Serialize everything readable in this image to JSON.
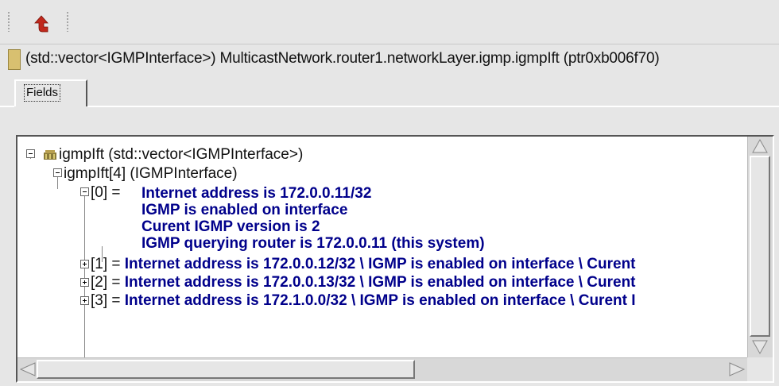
{
  "toolbar": {
    "up_icon": "up-arrow-icon",
    "up_color": "#c0281c"
  },
  "object_bar": {
    "text": "(std::vector<IGMPInterface>) MulticastNetwork.router1.networkLayer.igmp.igmpIft  (ptr0xb006f70)"
  },
  "tabs": [
    {
      "label": "Fields",
      "selected": true
    }
  ],
  "tree": {
    "root": {
      "label": "igmpIft (std::vector<IGMPInterface>)",
      "icon": "object-icon",
      "expanded": true
    },
    "child": {
      "label": "igmpIft[4] (IGMPInterface)",
      "expanded": true
    },
    "items": [
      {
        "index": "[0] = ",
        "expanded": true,
        "lines": [
          "Internet address is 172.0.0.11/32",
          "IGMP is enabled on interface",
          "Curent IGMP version is 2",
          "IGMP querying router is 172.0.0.11 (this system)"
        ]
      },
      {
        "index": "[1] = ",
        "expanded": false,
        "value": "Internet address is 172.0.0.12/32 \\ IGMP is enabled on interface \\ Curent"
      },
      {
        "index": "[2] = ",
        "expanded": false,
        "value": "Internet address is 172.0.0.13/32 \\ IGMP is enabled on interface \\ Curent"
      },
      {
        "index": "[3] = ",
        "expanded": false,
        "value": "Internet address is 172.1.0.0/32 \\ IGMP is enabled on interface \\ Curent I"
      }
    ]
  },
  "colors": {
    "value_text": "#00008b",
    "background": "#e6e6e6",
    "object_icon": "#d8c070"
  }
}
